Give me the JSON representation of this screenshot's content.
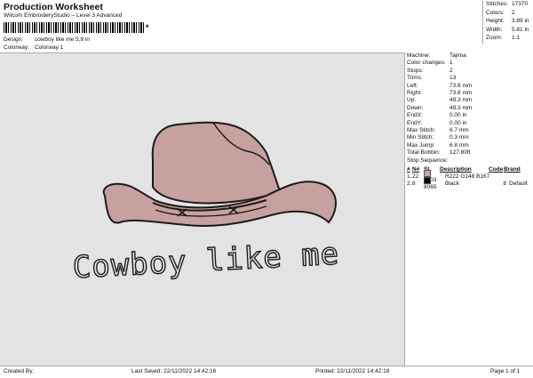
{
  "header": {
    "title": "Production Worksheet",
    "subtitle": "Wilcom EmbroideryStudio – Level 3 Advanced",
    "barcode_suffix": "*",
    "design_label": "Design:",
    "design_value": "cowboy like me 5,8 in",
    "colorway_label": "Colorway:",
    "colorway_value": "Colorway 1"
  },
  "summary": [
    {
      "k": "Stitches:",
      "v": "17370"
    },
    {
      "k": "Colors:",
      "v": "2"
    },
    {
      "k": "Height:",
      "v": "3.89 in"
    },
    {
      "k": "Width:",
      "v": "5.81 in"
    },
    {
      "k": "Zoom:",
      "v": "1:1"
    }
  ],
  "design_text": "Cowboy like me",
  "colors": {
    "hat": "#c9a3a1",
    "outline": "#1a1a1a",
    "canvas": "#e3e3e3"
  },
  "details": [
    {
      "k": "Machine:",
      "v": "Tajima"
    },
    {
      "k": "Color changes:",
      "v": "1"
    },
    {
      "k": "Stops:",
      "v": "2"
    },
    {
      "k": "Trims:",
      "v": "13"
    },
    {
      "k": "Left:",
      "v": "73.8 mm"
    },
    {
      "k": "Right:",
      "v": "73.8 mm"
    },
    {
      "k": "Up:",
      "v": "49.3 mm"
    },
    {
      "k": "Down:",
      "v": "49.3 mm"
    },
    {
      "k": "EndX:",
      "v": "0.00 in"
    },
    {
      "k": "EndY:",
      "v": "0.00 in"
    },
    {
      "k": "Max Stitch:",
      "v": "6.7 mm"
    },
    {
      "k": "Min Stitch:",
      "v": "0.3 mm"
    },
    {
      "k": "Max Jump:",
      "v": "6.8 mm"
    },
    {
      "k": "Total Bobbin:",
      "v": "127.80ft"
    }
  ],
  "stop_sequence": {
    "title": "Stop Sequence:",
    "headers": [
      "#",
      "N#",
      "St.",
      "Description",
      "Code",
      "Brand"
    ],
    "rows": [
      {
        "num": "1.",
        "n": "22",
        "swatch": "#d6a3ab",
        "st": "9303",
        "desc": "R222 G148 B167",
        "code": "",
        "brand": ""
      },
      {
        "num": "2.",
        "n": "8",
        "swatch": "#000000",
        "st": "8065",
        "desc": "Black",
        "code": "8",
        "brand": "Default"
      }
    ]
  },
  "footer": {
    "created": "Created By:",
    "saved": "Last Saved: 22/11/2022 14:42:16",
    "printed": "Printed: 22/11/2022 14:42:18",
    "page": "Page 1 of 1"
  }
}
